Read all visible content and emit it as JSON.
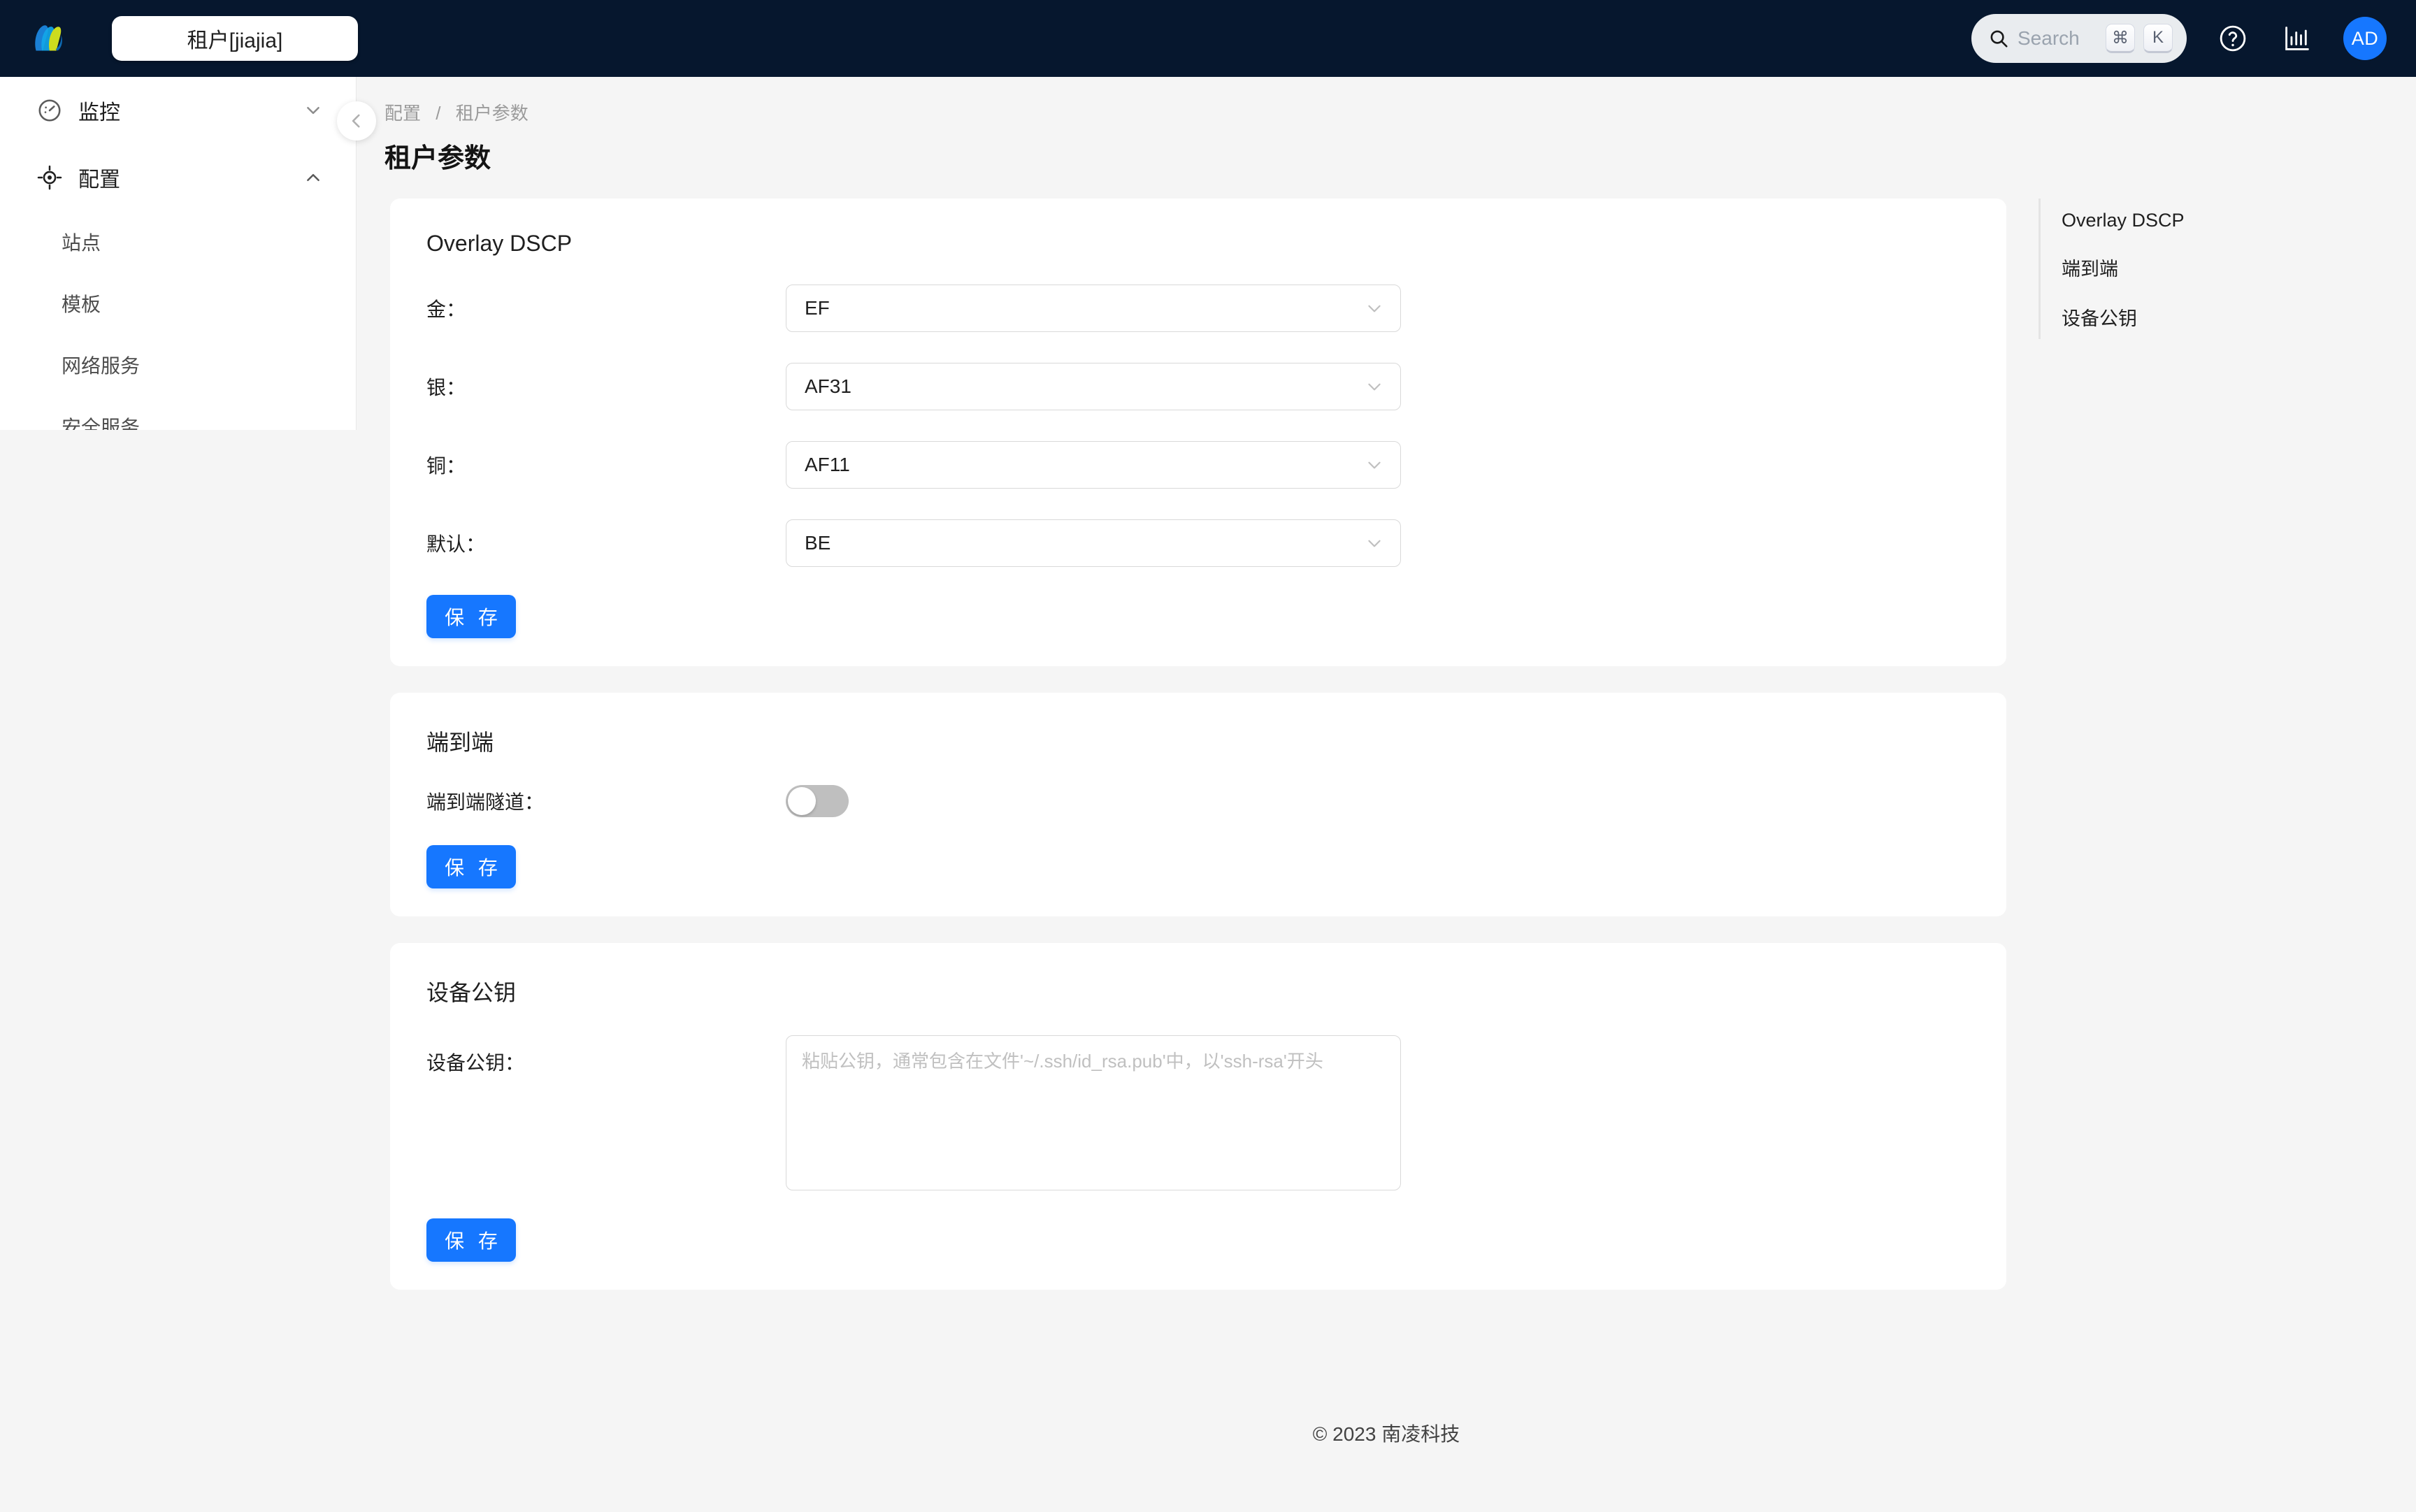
{
  "header": {
    "logo_icon": "nanlink-m-logo",
    "tenant_label": "租户[jiajia]",
    "search": {
      "icon": "search-icon",
      "placeholder": "Search",
      "key_cmd": "⌘",
      "key_letter": "K"
    },
    "help_icon": "question-circle-icon",
    "stats_icon": "bar-chart-icon",
    "avatar_initials": "AD",
    "avatar_color": "#1677ff",
    "background_color": "#06172e"
  },
  "sidebar": {
    "collapse_icon": "chevron-left-icon",
    "groups": [
      {
        "label": "监控",
        "icon": "dashboard-gauge-icon",
        "chevron": "chevron-down-icon",
        "expanded": false,
        "items": []
      },
      {
        "label": "配置",
        "icon": "aim-crosshair-icon",
        "chevron": "chevron-up-icon",
        "expanded": true,
        "items": [
          {
            "label": "站点"
          },
          {
            "label": "模板"
          },
          {
            "label": "网络服务"
          },
          {
            "label": "安全服务"
          }
        ]
      }
    ]
  },
  "page": {
    "breadcrumb": {
      "parent": "配置",
      "separator": "/",
      "current": "租户参数"
    },
    "title": "租户参数"
  },
  "cards": [
    {
      "id": "overlay-dscp",
      "title": "Overlay DSCP",
      "rows": [
        {
          "label": "金：",
          "type": "select",
          "value": "EF",
          "icon": "chevron-down-icon"
        },
        {
          "label": "银：",
          "type": "select",
          "value": "AF31",
          "icon": "chevron-down-icon"
        },
        {
          "label": "铜：",
          "type": "select",
          "value": "AF11",
          "icon": "chevron-down-icon"
        },
        {
          "label": "默认：",
          "type": "select",
          "value": "BE",
          "icon": "chevron-down-icon"
        }
      ],
      "save_label": "保 存"
    },
    {
      "id": "end-to-end",
      "title": "端到端",
      "rows": [
        {
          "label": "端到端隧道：",
          "type": "switch",
          "checked": false,
          "state_text": "关闭"
        }
      ],
      "save_label": "保 存"
    },
    {
      "id": "device-public-key",
      "title": "设备公钥",
      "rows": [
        {
          "label": "设备公钥：",
          "type": "textarea",
          "value": "",
          "placeholder": "粘贴公钥，通常包含在文件'~/.ssh/id_rsa.pub'中，以'ssh-rsa'开头"
        }
      ],
      "save_label": "保 存"
    }
  ],
  "anchor_nav": {
    "items": [
      {
        "label": "Overlay DSCP",
        "active": true
      },
      {
        "label": "端到端",
        "active": false
      },
      {
        "label": "设备公钥",
        "active": false
      }
    ]
  },
  "footer": {
    "text": "© 2023 南凌科技"
  },
  "theme": {
    "primary": "#1677ff",
    "page_background": "#f5f5f5",
    "card_background": "#ffffff",
    "border": "#d9d9d9"
  }
}
